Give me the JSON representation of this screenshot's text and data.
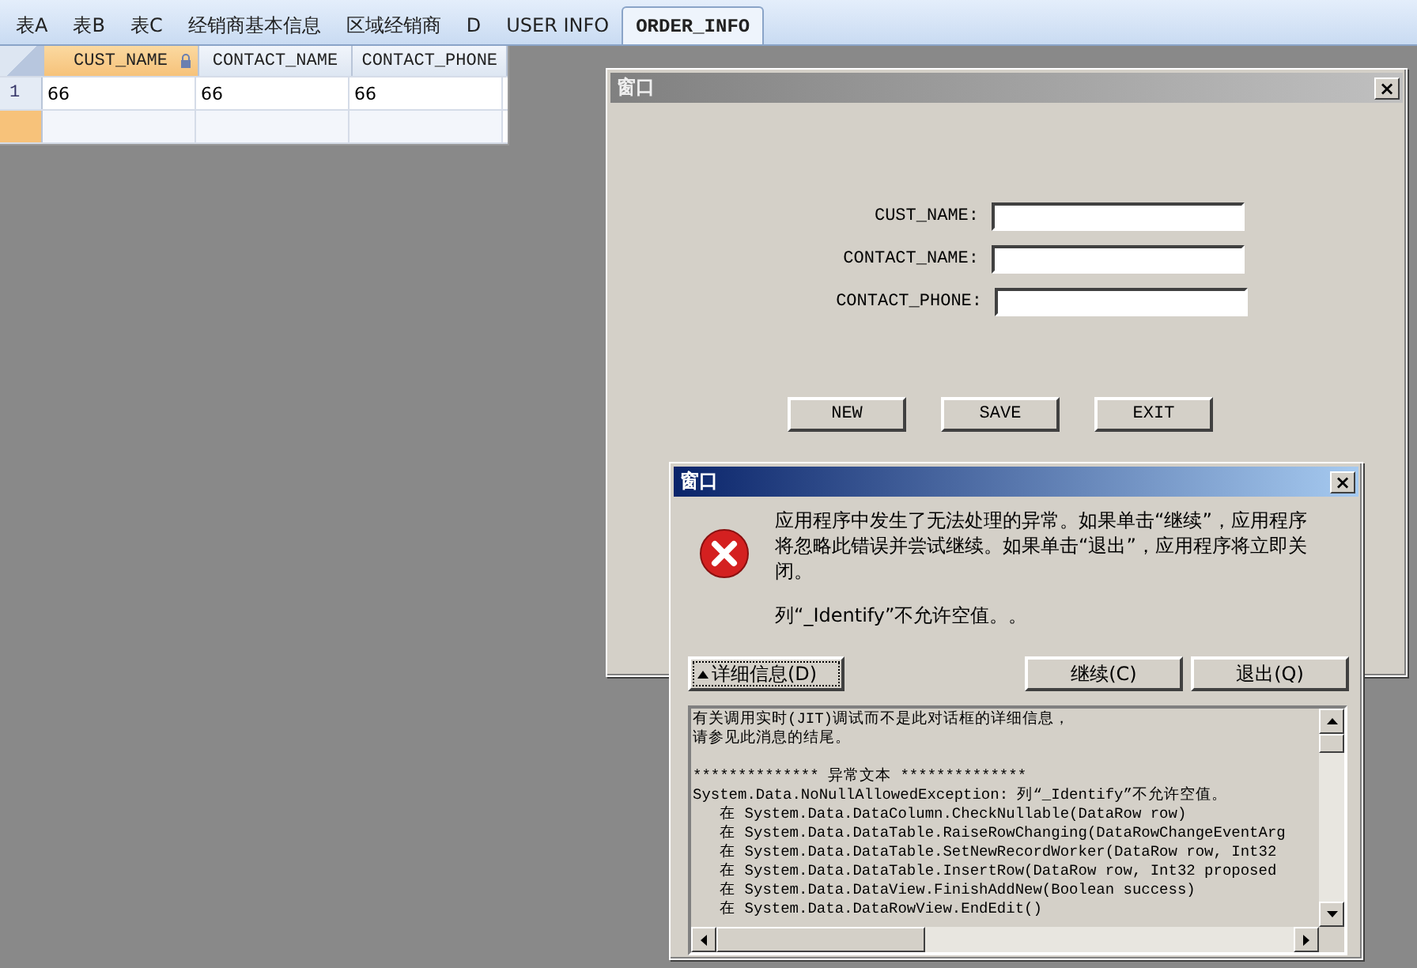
{
  "tabs": [
    {
      "label": "表A",
      "selected": false
    },
    {
      "label": "表B",
      "selected": false
    },
    {
      "label": "表C",
      "selected": false
    },
    {
      "label": "经销商基本信息",
      "selected": false
    },
    {
      "label": "区域经销商",
      "selected": false
    },
    {
      "label": "D",
      "selected": false
    },
    {
      "label": "USER INFO",
      "selected": false
    },
    {
      "label": "ORDER_INFO",
      "selected": true
    }
  ],
  "grid": {
    "columns": [
      {
        "label": "CUST_NAME",
        "selected": true
      },
      {
        "label": "CONTACT_NAME",
        "selected": false
      },
      {
        "label": "CONTACT_PHONE",
        "selected": false
      }
    ],
    "rows": [
      {
        "number": "1",
        "cells": [
          "66",
          "66",
          "66"
        ]
      }
    ]
  },
  "form_window": {
    "title": "窗口",
    "close": "×",
    "fields": [
      {
        "label": "CUST_NAME:"
      },
      {
        "label": "CONTACT_NAME:"
      },
      {
        "label": "CONTACT_PHONE:"
      }
    ],
    "buttons": [
      "NEW",
      "SAVE",
      "EXIT"
    ]
  },
  "error_dialog": {
    "title": "窗口",
    "close": "×",
    "message": "应用程序中发生了无法处理的异常。如果单击“继续”，应用程序将忽略此错误并尝试继续。如果单击“退出”，应用程序将立即关闭。",
    "detail_message": "列“_Identify”不允许空值。。",
    "details_button": "详细信息(D)",
    "buttons": [
      "继续(C)",
      "退出(Q)"
    ],
    "details": [
      "有关调用实时(JIT)调试而不是此对话框的详细信息，",
      "请参见此消息的结尾。",
      "************** 异常文本 **************",
      "System.Data.NoNullAllowedException: 列“_Identify”不允许空值。",
      "   在 System.Data.DataColumn.CheckNullable(DataRow row)",
      "   在 System.Data.DataTable.RaiseRowChanging(DataRowChangeEventArg",
      "   在 System.Data.DataTable.SetNewRecordWorker(DataRow row, Int32",
      "   在 System.Data.DataTable.InsertRow(DataRow row, Int32 proposed",
      "   在 System.Data.DataView.FinishAddNew(Boolean success)",
      "   在 System.Data.DataRowView.EndEdit()"
    ]
  }
}
